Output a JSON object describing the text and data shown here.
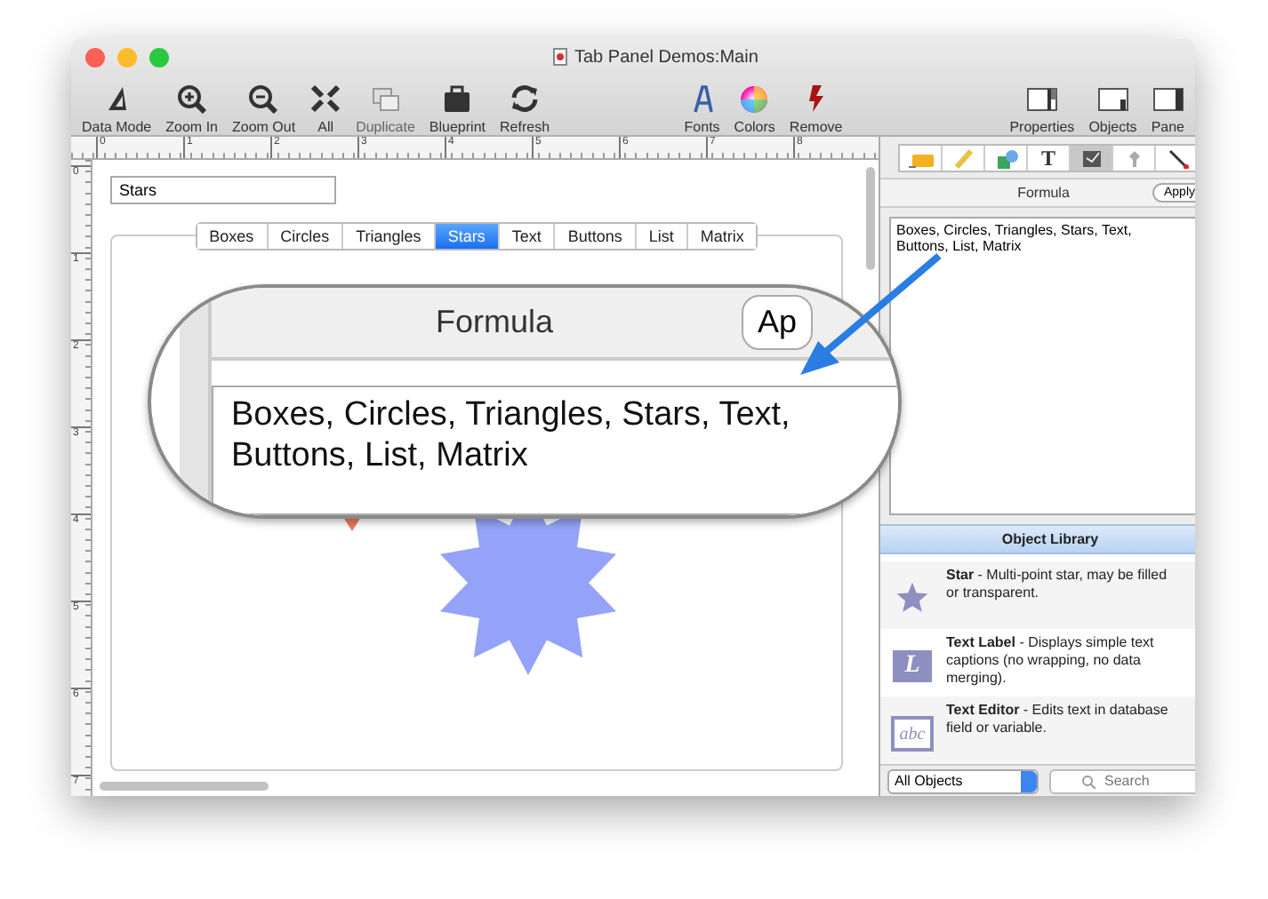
{
  "window": {
    "title": "Tab Panel Demos:Main"
  },
  "toolbar": {
    "left": [
      {
        "kind": "data-mode",
        "label": "Data Mode",
        "disabled": false
      },
      {
        "kind": "zoom-in",
        "label": "Zoom In",
        "disabled": false
      },
      {
        "kind": "zoom-out",
        "label": "Zoom Out",
        "disabled": false
      },
      {
        "kind": "all",
        "label": "All",
        "disabled": false
      },
      {
        "kind": "duplicate",
        "label": "Duplicate",
        "disabled": true
      },
      {
        "kind": "blueprint",
        "label": "Blueprint",
        "disabled": false
      },
      {
        "kind": "refresh",
        "label": "Refresh",
        "disabled": false
      }
    ],
    "middle": [
      {
        "kind": "fonts",
        "label": "Fonts",
        "disabled": false
      },
      {
        "kind": "colors",
        "label": "Colors",
        "disabled": false
      },
      {
        "kind": "remove",
        "label": "Remove",
        "disabled": false
      }
    ],
    "right": [
      {
        "kind": "properties",
        "label": "Properties",
        "disabled": false
      },
      {
        "kind": "objects",
        "label": "Objects",
        "disabled": false
      },
      {
        "kind": "pane",
        "label": "Pane",
        "disabled": false
      }
    ]
  },
  "ruler": {
    "horizontal": [
      "0",
      "1",
      "2",
      "3",
      "4",
      "5",
      "6",
      "7",
      "8"
    ],
    "vertical": [
      "0",
      "1",
      "2",
      "3",
      "4",
      "5",
      "6",
      "7"
    ]
  },
  "canvas": {
    "field": {
      "value": "Stars"
    },
    "tabs": [
      {
        "label": "Boxes",
        "selected": false
      },
      {
        "label": "Circles",
        "selected": false
      },
      {
        "label": "Triangles",
        "selected": false
      },
      {
        "label": "Stars",
        "selected": true
      },
      {
        "label": "Text",
        "selected": false
      },
      {
        "label": "Buttons",
        "selected": false
      },
      {
        "label": "List",
        "selected": false
      },
      {
        "label": "Matrix",
        "selected": false
      }
    ],
    "callout": {
      "header": "Formula",
      "button": "Ap",
      "text": "Boxes, Circles, Triangles, Stars, Text, Buttons, List, Matrix"
    }
  },
  "inspector": {
    "tools": [
      {
        "kind": "label",
        "selected": false
      },
      {
        "kind": "ruler",
        "selected": false
      },
      {
        "kind": "shapes",
        "selected": false
      },
      {
        "kind": "text",
        "glyph": "T",
        "selected": false
      },
      {
        "kind": "formula",
        "selected": true
      },
      {
        "kind": "pin",
        "selected": false
      },
      {
        "kind": "wand",
        "selected": false
      }
    ],
    "header": "Formula",
    "apply": "Apply",
    "formula": "Boxes, Circles, Triangles, Stars, Text, Buttons, List, Matrix"
  },
  "library": {
    "title": "Object Library",
    "items": [
      {
        "kind": "star",
        "text": "**Star** - Multi-point star, may be filled or transparent."
      },
      {
        "kind": "text-label",
        "glyph": "L",
        "text": "**Text Label** - Displays simple text captions (no wrapping, no data merging)."
      },
      {
        "kind": "text-editor",
        "glyph": "abc",
        "text": "**Text Editor** - Edits text in database field or variable."
      }
    ],
    "filter": "All Objects",
    "search": {
      "placeholder": "Search"
    }
  }
}
